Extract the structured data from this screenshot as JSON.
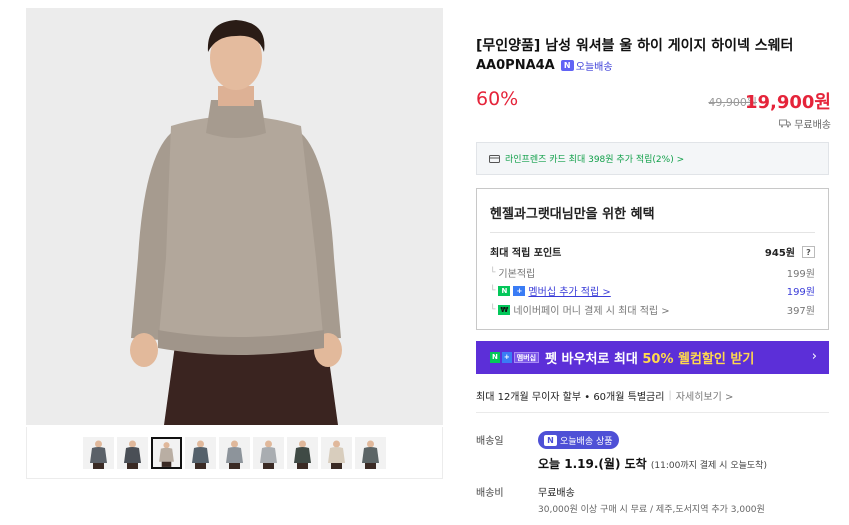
{
  "product": {
    "title": "[무인양품] 남성 워셔블 울 하이 게이지 하이넥 스웨터",
    "code": "AA0PNA4A",
    "today_delivery_tag": "오늘배송",
    "n_badge": "N",
    "discount_rate": "60%",
    "original_price": "49,900원",
    "sale_price": "19,900원",
    "free_shipping": "무료배송",
    "free_shipping_icon": "truck-icon"
  },
  "gallery": {
    "selected_index": 2,
    "thumbnails": [
      {
        "color": "#5b6168"
      },
      {
        "color": "#4a4f56"
      },
      {
        "color": "#b9aea3"
      },
      {
        "color": "#55616b"
      },
      {
        "color": "#8d949b"
      },
      {
        "color": "#a9adb1"
      },
      {
        "color": "#3f4a45"
      },
      {
        "color": "#d8cdbd"
      },
      {
        "color": "#5c6566"
      }
    ]
  },
  "card_banner": {
    "icon": "card-icon",
    "text": "라인프렌즈 카드 최대 398원 추가 적립(2%) >"
  },
  "benefits": {
    "title": "헨젤과그랫대님만을 위한 혜택",
    "max_points_label": "최대 적립 포인트",
    "max_points_value": "945원",
    "help": "?",
    "rows": [
      {
        "label": "기본적립",
        "value": "199원"
      },
      {
        "badge": "N +",
        "label": "멤버십 추가 적립 >",
        "value": "199원"
      },
      {
        "badge": "N",
        "label": "네이버페이 머니 결제 시 최대 적립 >",
        "value": "397원"
      }
    ]
  },
  "promo": {
    "badge_n": "N",
    "badge_plus": "+",
    "badge_membership": "멤버십",
    "text_before": "펫 바우처로 최대 ",
    "text_highlight": "50% 웰컴할인 받기",
    "arrow": "›"
  },
  "installment": {
    "text": "최대 12개월 무이자 할부 • 60개월 특별금리",
    "sep": "|",
    "more": "자세히보기 >"
  },
  "shipping": {
    "date_label": "배송일",
    "today_pill": "오늘배송 상품",
    "arrival_main": "오늘 1.19.(월) 도착",
    "arrival_note": "(11:00까지 결제 시 오늘도착)",
    "fee_label": "배송비",
    "fee_value": "무료배송",
    "fee_note": "30,000원 이상 구매 시 무료 / 제주,도서지역 추가 3,000원"
  },
  "colors": {
    "accent_red": "#e5243a",
    "naver_green": "#03c75a",
    "promo_purple": "#5c2fd8",
    "link_blue": "#3a3cd8"
  }
}
